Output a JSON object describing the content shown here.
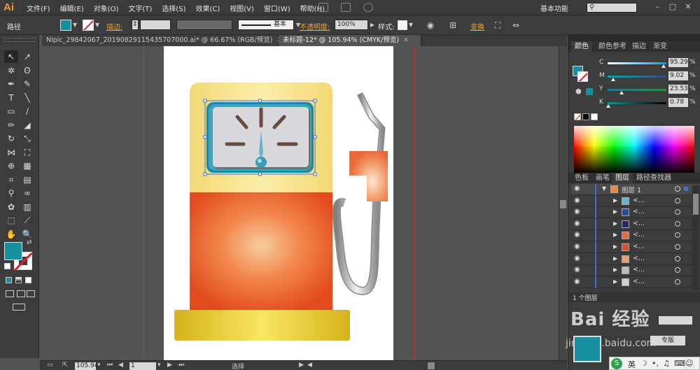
{
  "app": {
    "logo": "Ai"
  },
  "menu": [
    "文件(F)",
    "编辑(E)",
    "对象(O)",
    "文字(T)",
    "选择(S)",
    "效果(C)",
    "视图(V)",
    "窗口(W)",
    "帮助(H)"
  ],
  "workspace": {
    "label": "基本功能"
  },
  "window_buttons": [
    "–",
    "□",
    "✕"
  ],
  "control": {
    "selection_type": "路径",
    "fill_color": "#1790a0",
    "stroke_label": "描边:",
    "stroke_style": "基本",
    "opacity_label": "不透明度:",
    "opacity_value": "100%",
    "style_label": "样式:",
    "transform_link": "变换"
  },
  "tabs": [
    {
      "label": "Nipic_29842067_20190829115435707000.ai* @ 66.67% (RGB/预览)",
      "close": "✕",
      "active": false
    },
    {
      "label": "未标题-12* @ 105.94% (CMYK/预览)",
      "close": "✕",
      "active": true
    }
  ],
  "toolbar": {
    "tools": [
      {
        "name": "selection-tool",
        "glyph": "↖"
      },
      {
        "name": "direct-selection-tool",
        "glyph": "↗"
      },
      {
        "name": "magic-wand-tool",
        "glyph": "✲"
      },
      {
        "name": "lasso-tool",
        "glyph": "ʘ"
      },
      {
        "name": "pen-tool",
        "glyph": "✒"
      },
      {
        "name": "curvature-tool",
        "glyph": "✎"
      },
      {
        "name": "type-tool",
        "glyph": "T"
      },
      {
        "name": "line-tool",
        "glyph": "╲"
      },
      {
        "name": "rectangle-tool",
        "glyph": "▭"
      },
      {
        "name": "paintbrush-tool",
        "glyph": "∕"
      },
      {
        "name": "pencil-tool",
        "glyph": "✏"
      },
      {
        "name": "eraser-tool",
        "glyph": "◢"
      },
      {
        "name": "rotate-tool",
        "glyph": "↻"
      },
      {
        "name": "scale-tool",
        "glyph": "⤡"
      },
      {
        "name": "width-tool",
        "glyph": "⋈"
      },
      {
        "name": "free-transform-tool",
        "glyph": "⛶"
      },
      {
        "name": "shape-builder-tool",
        "glyph": "⊕"
      },
      {
        "name": "perspective-grid-tool",
        "glyph": "▦"
      },
      {
        "name": "mesh-tool",
        "glyph": "⌗"
      },
      {
        "name": "gradient-tool",
        "glyph": "▤"
      },
      {
        "name": "eyedropper-tool",
        "glyph": "⚲"
      },
      {
        "name": "blend-tool",
        "glyph": "∞"
      },
      {
        "name": "symbol-sprayer-tool",
        "glyph": "✿"
      },
      {
        "name": "column-graph-tool",
        "glyph": "▥"
      },
      {
        "name": "artboard-tool",
        "glyph": "⬚"
      },
      {
        "name": "slice-tool",
        "glyph": "⟋"
      },
      {
        "name": "hand-tool",
        "glyph": "✋"
      },
      {
        "name": "zoom-tool",
        "glyph": "🔍"
      }
    ]
  },
  "status": {
    "zoom": "105.94",
    "artboard": "1",
    "tool_label": "选择"
  },
  "color_panel": {
    "tabs": [
      "颜色",
      "颜色参考",
      "描边",
      "渐变"
    ],
    "channels": [
      {
        "label": "C",
        "value": "95.29",
        "unit": "%",
        "position": 0.95,
        "track_from": "#ffffff",
        "track_to": "#00a0e9"
      },
      {
        "label": "M",
        "value": "9.02",
        "unit": "%",
        "position": 0.09,
        "track_from": "#14a0b0",
        "track_to": "#2b4a9e"
      },
      {
        "label": "Y",
        "value": "23.53",
        "unit": "%",
        "position": 0.24,
        "track_from": "#0e7fa0",
        "track_to": "#1a9a3c"
      },
      {
        "label": "K",
        "value": "0.78",
        "unit": "%",
        "position": 0.01,
        "track_from": "#1790a0",
        "track_to": "#000000"
      }
    ]
  },
  "layers_panel": {
    "tabs": [
      "色板",
      "画笔",
      "图层",
      "路径查找器"
    ],
    "top_layer": "图层 1",
    "sublayer_label": "<...",
    "count_label": "1 个图层"
  },
  "watermark": {
    "main": "Bai 经验",
    "url": "jingyan.baidu.com"
  },
  "taskbar": {
    "ime_label": "英",
    "ime_extra": "专版"
  }
}
